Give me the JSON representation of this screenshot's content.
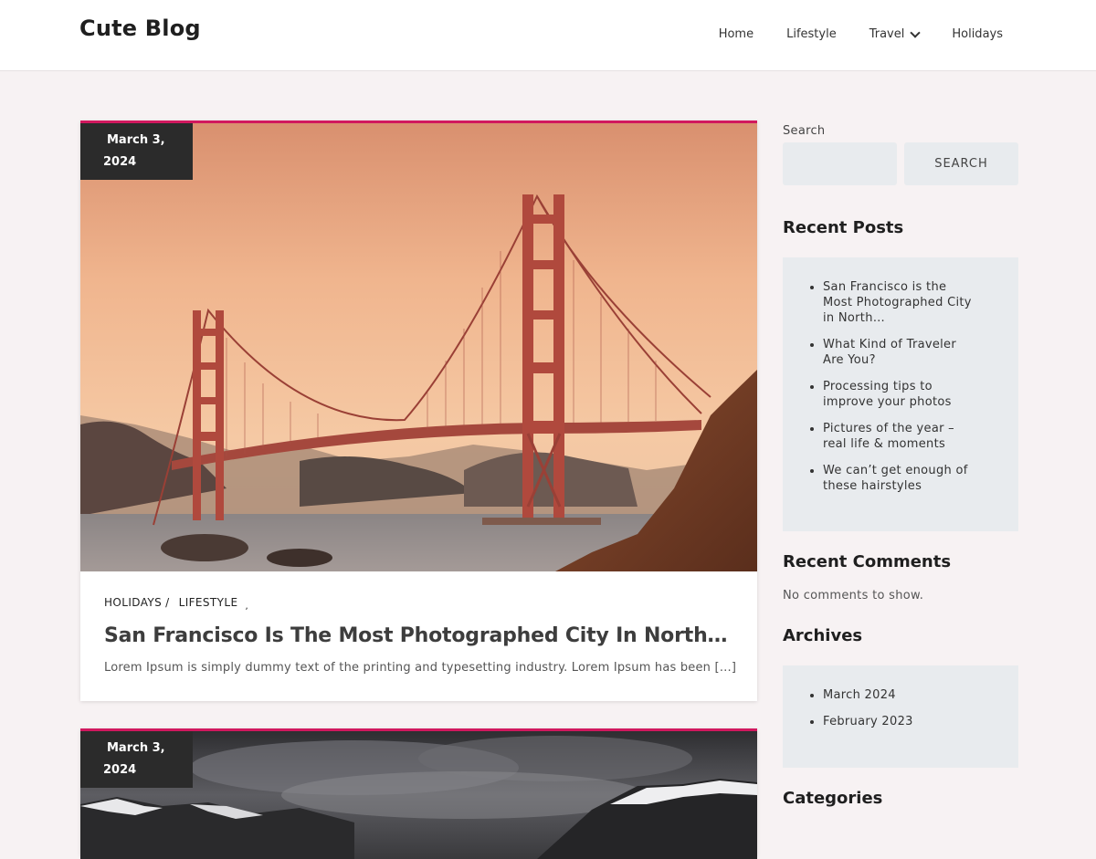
{
  "site": {
    "title": "Cute Blog"
  },
  "nav": {
    "items": [
      {
        "label": "Home"
      },
      {
        "label": "Lifestyle"
      },
      {
        "label": "Travel",
        "has_submenu": true,
        "icon": "chevron-down-icon"
      },
      {
        "label": "Holidays"
      }
    ]
  },
  "posts": [
    {
      "date_line1": "March 3,",
      "date_line2": "2024",
      "categories": [
        "HOLIDAYS",
        "LIFESTYLE"
      ],
      "category_separator": "/",
      "trailing_mark": ",",
      "title": "San Francisco Is The Most Photographed City In North…",
      "excerpt": "Lorem Ipsum is simply dummy text of the printing and typesetting industry. Lorem Ipsum has been […]",
      "image": "golden-gate-bridge-photo"
    },
    {
      "date_line1": "March 3,",
      "date_line2": "2024",
      "image": "stormy-mountains-photo"
    }
  ],
  "sidebar": {
    "search": {
      "label": "Search",
      "button_label": "SEARCH",
      "value": ""
    },
    "recent_posts": {
      "title": "Recent Posts",
      "items": [
        "San Francisco is the Most Photographed City in North…",
        "What Kind of Traveler Are You?",
        "Processing tips to improve your photos",
        "Pictures of the year – real life & moments",
        "We can’t get enough of these hairstyles"
      ]
    },
    "recent_comments": {
      "title": "Recent Comments",
      "empty_text": "No comments to show."
    },
    "archives": {
      "title": "Archives",
      "items": [
        "March 2024",
        "February 2023"
      ]
    },
    "categories": {
      "title": "Categories"
    }
  },
  "colors": {
    "accent": "#d1185e",
    "badge": "#2b2b2b",
    "page_bg": "#f7f2f3",
    "widget_bg": "#e8ebee"
  }
}
